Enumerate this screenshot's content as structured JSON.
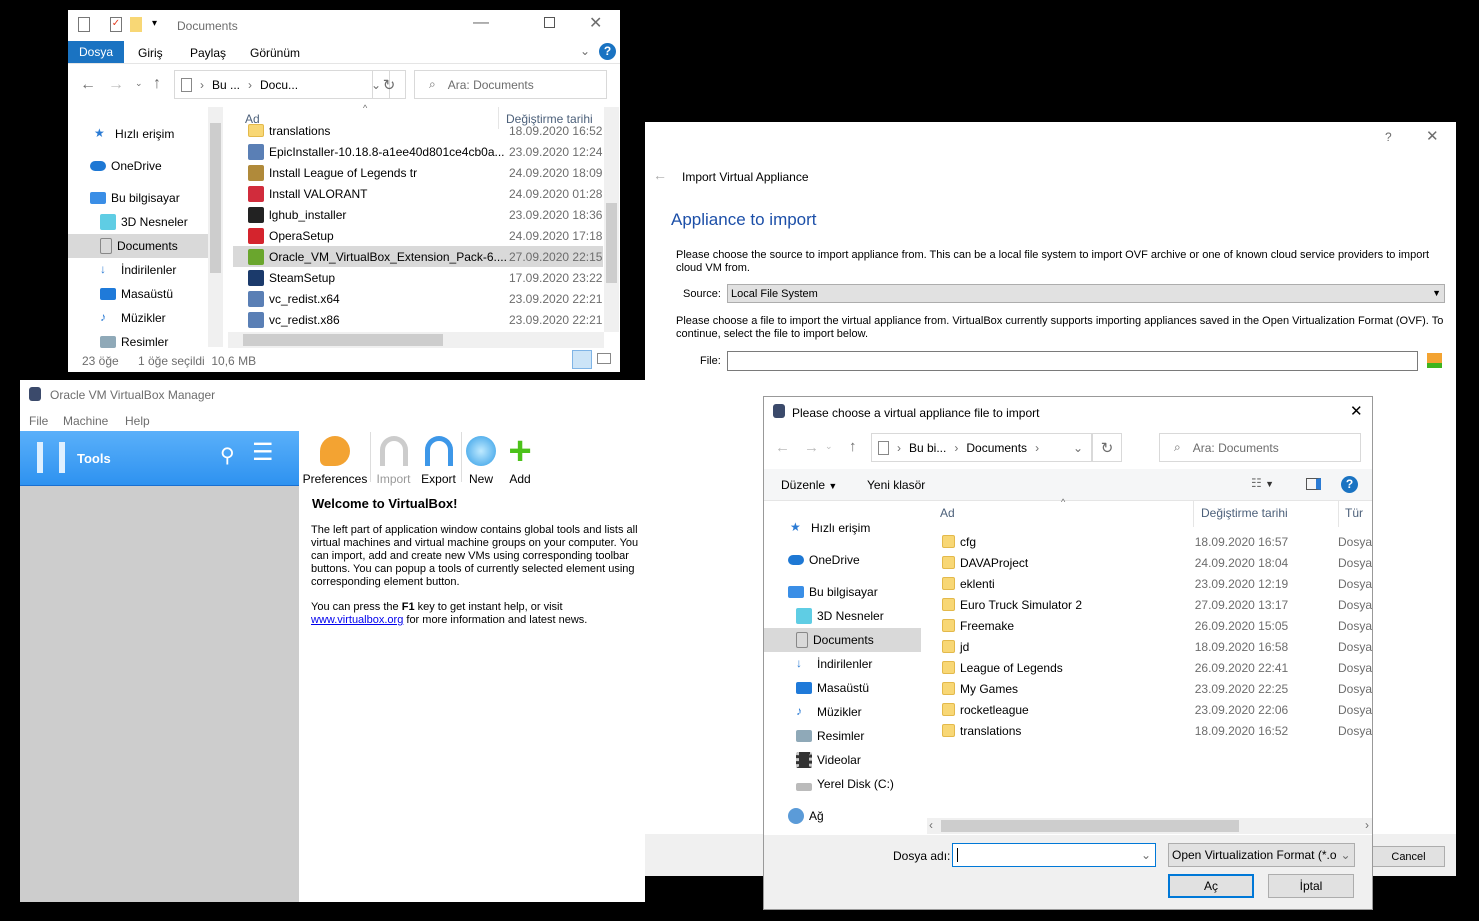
{
  "explorer": {
    "title": "Documents",
    "tabs": [
      "Dosya",
      "Giriş",
      "Paylaş",
      "Görünüm"
    ],
    "breadcrumb": [
      "Bu ...",
      "Docu..."
    ],
    "search_placeholder": "Ara: Documents",
    "nav": [
      "Hızlı erişim",
      "OneDrive",
      "Bu bilgisayar",
      "3D Nesneler",
      "Documents",
      "İndirilenler",
      "Masaüstü",
      "Müzikler",
      "Resimler"
    ],
    "col_name": "Ad",
    "col_date": "Değiştirme tarihi",
    "files": [
      {
        "name": "translations",
        "date": "18.09.2020 16:52",
        "icon": "folder",
        "color": "#f8d775"
      },
      {
        "name": "EpicInstaller-10.18.8-a1ee40d801ce4cb0a...",
        "date": "23.09.2020 12:24",
        "icon": "installer",
        "color": "#5a7fb5"
      },
      {
        "name": "Install League of Legends tr",
        "date": "24.09.2020 18:09",
        "icon": "league",
        "color": "#b08a3a"
      },
      {
        "name": "Install VALORANT",
        "date": "24.09.2020 01:28",
        "icon": "valorant",
        "color": "#d12c3c"
      },
      {
        "name": "lghub_installer",
        "date": "23.09.2020 18:36",
        "icon": "logitech",
        "color": "#222222"
      },
      {
        "name": "OperaSetup",
        "date": "24.09.2020 17:18",
        "icon": "opera",
        "color": "#d4242d"
      },
      {
        "name": "Oracle_VM_VirtualBox_Extension_Pack-6....",
        "date": "27.09.2020 22:15",
        "icon": "cube",
        "color": "#6aa62d"
      },
      {
        "name": "SteamSetup",
        "date": "17.09.2020 23:22",
        "icon": "steam",
        "color": "#1b3a6b"
      },
      {
        "name": "vc_redist.x64",
        "date": "23.09.2020 22:21",
        "icon": "installer",
        "color": "#5a7fb5"
      },
      {
        "name": "vc_redist.x86",
        "date": "23.09.2020 22:21",
        "icon": "installer",
        "color": "#5a7fb5"
      }
    ],
    "selected_index": 6,
    "status_count": "23 öğe",
    "status_selected": "1 öğe seçildi  10,6 MB"
  },
  "vbox": {
    "title": "Oracle VM VirtualBox Manager",
    "menu": [
      "File",
      "Machine",
      "Help"
    ],
    "tools_label": "Tools",
    "toolbar": [
      "Preferences",
      "Import",
      "Export",
      "New",
      "Add"
    ],
    "welcome_title": "Welcome to VirtualBox!",
    "welcome_p1": "The left part of application window contains global tools and lists all virtual machines and virtual machine groups on your computer. You can import, add and create new VMs using corresponding toolbar buttons. You can popup a tools of currently selected element using corresponding element button.",
    "welcome_p2a": "You can press the ",
    "welcome_key": "F1",
    "welcome_p2b": " key to get instant help, or visit ",
    "welcome_link": "www.virtualbox.org",
    "welcome_p2c": " for more information and latest news."
  },
  "import": {
    "help": "?",
    "title": "Import Virtual Appliance",
    "heading": "Appliance to import",
    "desc1": "Please choose the source to import appliance from. This can be a local file system to import OVF archive or one of known cloud service providers to import cloud VM from.",
    "source_label": "Source:",
    "source_value": "Local File System",
    "desc2": "Please choose a file to import the virtual appliance from. VirtualBox currently supports importing appliances saved in the Open Virtualization Format (OVF). To continue, select the file to import below.",
    "file_label": "File:",
    "file_value": "",
    "cancel": "Cancel"
  },
  "chooser": {
    "title": "Please choose a virtual appliance file to import",
    "breadcrumb": [
      "Bu bi...",
      "Documents"
    ],
    "search_placeholder": "Ara: Documents",
    "organize": "Düzenle",
    "new_folder": "Yeni klasör",
    "nav": [
      "Hızlı erişim",
      "OneDrive",
      "Bu bilgisayar",
      "3D Nesneler",
      "Documents",
      "İndirilenler",
      "Masaüstü",
      "Müzikler",
      "Resimler",
      "Videolar",
      "Yerel Disk (C:)",
      "Ağ"
    ],
    "col_name": "Ad",
    "col_date": "Değiştirme tarihi",
    "col_type": "Tür",
    "files": [
      {
        "name": "cfg",
        "date": "18.09.2020 16:57",
        "type": "Dosya"
      },
      {
        "name": "DAVAProject",
        "date": "24.09.2020 18:04",
        "type": "Dosya"
      },
      {
        "name": "eklenti",
        "date": "23.09.2020 12:19",
        "type": "Dosya"
      },
      {
        "name": "Euro Truck Simulator 2",
        "date": "27.09.2020 13:17",
        "type": "Dosya"
      },
      {
        "name": "Freemake",
        "date": "26.09.2020 15:05",
        "type": "Dosya"
      },
      {
        "name": "jd",
        "date": "18.09.2020 16:58",
        "type": "Dosya"
      },
      {
        "name": "League of Legends",
        "date": "26.09.2020 22:41",
        "type": "Dosya"
      },
      {
        "name": "My Games",
        "date": "23.09.2020 22:25",
        "type": "Dosya"
      },
      {
        "name": "rocketleague",
        "date": "23.09.2020 22:06",
        "type": "Dosya"
      },
      {
        "name": "translations",
        "date": "18.09.2020 16:52",
        "type": "Dosya"
      }
    ],
    "filename_label": "Dosya adı:",
    "filename_value": "",
    "filter": "Open Virtualization Format (*.o",
    "open": "Aç",
    "cancel": "İptal"
  }
}
